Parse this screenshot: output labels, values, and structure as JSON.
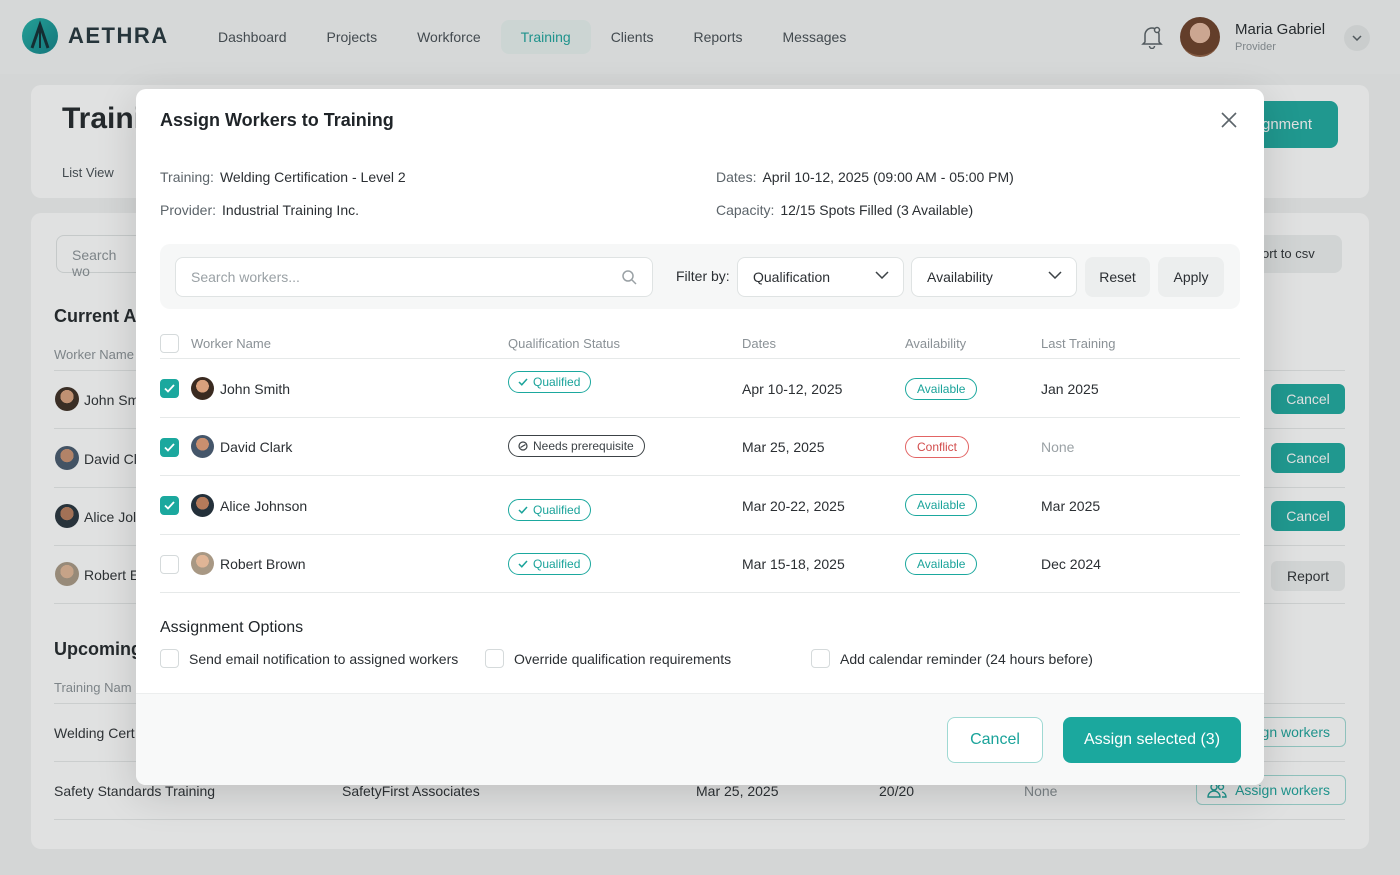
{
  "brand": {
    "name": "AETHRA",
    "accent": "#1ba89e"
  },
  "nav": {
    "items": [
      {
        "label": "Dashboard",
        "active": false
      },
      {
        "label": "Projects",
        "active": false
      },
      {
        "label": "Workforce",
        "active": false
      },
      {
        "label": "Training",
        "active": true
      },
      {
        "label": "Clients",
        "active": false
      },
      {
        "label": "Reports",
        "active": false
      },
      {
        "label": "Messages",
        "active": false
      }
    ]
  },
  "user": {
    "name": "Maria Gabriel",
    "role": "Provider"
  },
  "background": {
    "title": "Traini",
    "view_tab": "List View",
    "new_button": "gnment",
    "search_placeholder": "Search wo",
    "export_label": "ort  to csv",
    "current_heading": "Current A",
    "current_col": "Worker Name",
    "current_rows": [
      {
        "name": "John Sm",
        "action": "Cancel"
      },
      {
        "name": "David Cl",
        "action": "Cancel"
      },
      {
        "name": "Alice Jol",
        "action": "Cancel"
      },
      {
        "name": "Robert E",
        "action": "Report"
      }
    ],
    "upcoming_heading": "Upcoming",
    "upcoming_col": "Training Nam",
    "upcoming_rows": [
      {
        "name": "Welding Cert",
        "provider": "",
        "date": "",
        "capacity": "",
        "last": "",
        "action": "gn workers"
      },
      {
        "name": "Safety Standards Training",
        "provider": "SafetyFirst Associates",
        "date": "Mar 25, 2025",
        "capacity": "20/20",
        "last": "None",
        "action": "Assign workers"
      }
    ]
  },
  "modal": {
    "title": "Assign Workers to Training",
    "info": {
      "training_label": "Training:",
      "training_value": "Welding Certification - Level 2",
      "provider_label": "Provider:",
      "provider_value": "Industrial Training Inc.",
      "dates_label": "Dates:",
      "dates_value": "April 10-12, 2025 (09:00 AM - 05:00 PM)",
      "capacity_label": "Capacity:",
      "capacity_value": "12/15 Spots Filled (3 Available)"
    },
    "filters": {
      "search_placeholder": "Search workers...",
      "filter_label": "Filter by:",
      "qualification": "Qualification",
      "availability": "Availability",
      "reset": "Reset",
      "apply": "Apply"
    },
    "columns": [
      "Worker Name",
      "Qualification Status",
      "Dates",
      "Availability",
      "Last Training"
    ],
    "workers": [
      {
        "name": "John Smith",
        "checked": true,
        "qualification": "Qualified",
        "qual_type": "q",
        "dates": "Apr 10-12, 2025",
        "availability": "Available",
        "avail_type": "av",
        "last": "Jan 2025",
        "last_muted": false
      },
      {
        "name": "David Clark",
        "checked": true,
        "qualification": "Needs prerequisite",
        "qual_type": "np",
        "dates": "Mar 25, 2025",
        "availability": "Conflict",
        "avail_type": "cf",
        "last": "None",
        "last_muted": true
      },
      {
        "name": "Alice Johnson",
        "checked": true,
        "qualification": "Qualified",
        "qual_type": "q",
        "dates": "Mar 20-22, 2025",
        "availability": "Available",
        "avail_type": "av",
        "last": "Mar 2025",
        "last_muted": false
      },
      {
        "name": "Robert Brown",
        "checked": false,
        "qualification": "Qualified",
        "qual_type": "q",
        "dates": "Mar 15-18, 2025",
        "availability": "Available",
        "avail_type": "av",
        "last": "Dec 2024",
        "last_muted": false
      }
    ],
    "options_title": "Assignment Options",
    "options": [
      "Send email notification to assigned workers",
      "Override qualification requirements",
      "Add calendar reminder (24 hours before)"
    ],
    "cancel_label": "Cancel",
    "assign_label": "Assign selected (3)"
  }
}
